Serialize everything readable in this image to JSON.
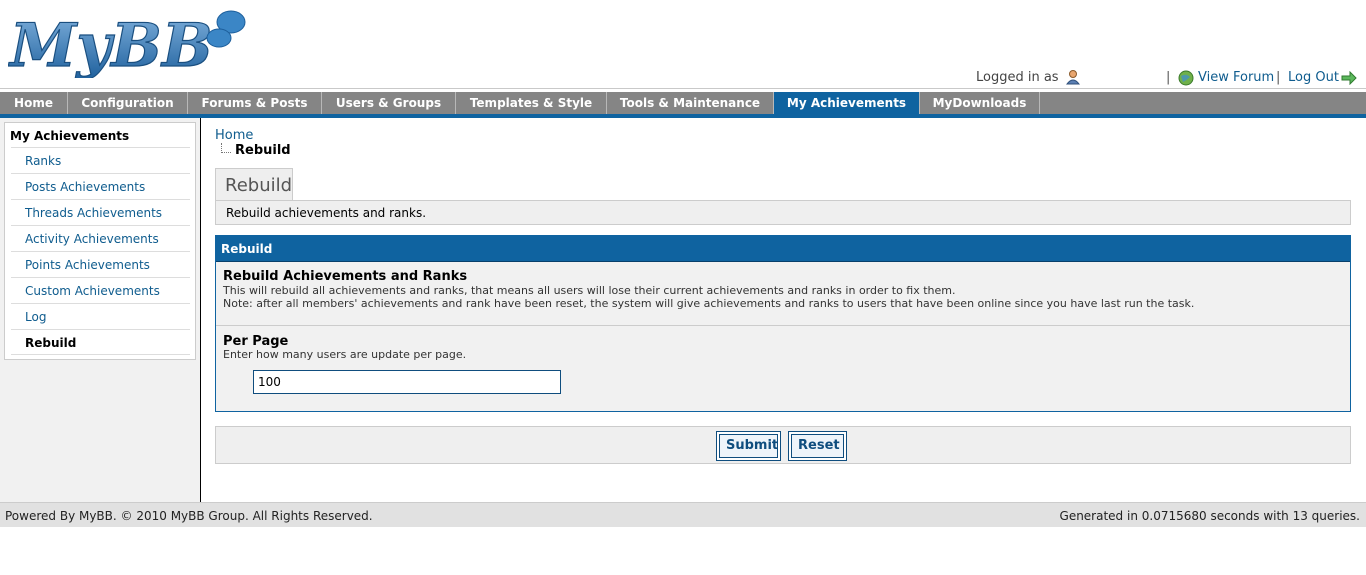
{
  "header": {
    "logo_text": "MyBB",
    "logged_in_label": "Logged in as",
    "separator": "|",
    "view_forum": "View Forum",
    "separator2": "|",
    "log_out": "Log Out"
  },
  "nav": {
    "tabs": [
      {
        "label": "Home"
      },
      {
        "label": "Configuration"
      },
      {
        "label": "Forums & Posts"
      },
      {
        "label": "Users & Groups"
      },
      {
        "label": "Templates & Style"
      },
      {
        "label": "Tools & Maintenance"
      },
      {
        "label": "My Achievements",
        "active": true
      },
      {
        "label": "MyDownloads"
      }
    ]
  },
  "sidebar": {
    "title": "My Achievements",
    "items": [
      {
        "label": "Ranks"
      },
      {
        "label": "Posts Achievements"
      },
      {
        "label": "Threads Achievements"
      },
      {
        "label": "Activity Achievements"
      },
      {
        "label": "Points Achievements"
      },
      {
        "label": "Custom Achievements"
      },
      {
        "label": "Log"
      },
      {
        "label": "Rebuild",
        "current": true
      }
    ]
  },
  "breadcrumb": {
    "home": "Home",
    "current": "Rebuild"
  },
  "page": {
    "tab_label": "Rebuild",
    "description": "Rebuild achievements and ranks.",
    "form_title": "Rebuild",
    "row1_title": "Rebuild Achievements and Ranks",
    "row1_desc1": "This will rebuild all achievements and ranks, that means all users will lose their current achievements and ranks in order to fix them.",
    "row1_desc2": "Note: after all members' achievements and rank have been reset, the system will give achievements and ranks to users that have been online since you have last run the task.",
    "row2_title": "Per Page",
    "row2_desc": "Enter how many users are update per page.",
    "per_page_value": "100",
    "submit_label": "Submit",
    "reset_label": "Reset"
  },
  "footer": {
    "left": "Powered By MyBB. © 2010 MyBB Group. All Rights Reserved.",
    "right": "Generated in 0.0715680 seconds with 13 queries."
  },
  "colors": {
    "accent": "#0f63a0",
    "nav_bg": "#858585",
    "link": "#0f5c8e"
  }
}
